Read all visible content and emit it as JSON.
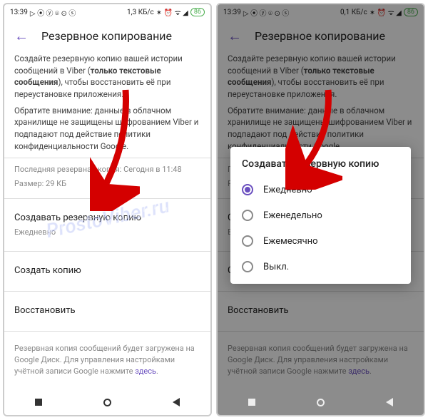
{
  "status": {
    "time": "13:39",
    "net_left": "1,3 КБ/с",
    "net_right": "0,1 КБ/с",
    "battery": "86"
  },
  "header": {
    "title": "Резервное копирование"
  },
  "intro": {
    "p1a": "Создайте резервную копию вашей истории сообщений в Viber (",
    "p1b": "только текстовые сообщения",
    "p1c": "), чтобы восстановить её при переустановке приложения.",
    "p2": "Обратите внимание: данные в облачном хранилище не защищены шифрованием Viber и подпадают под действие политики конфиденциальности Google."
  },
  "meta": {
    "last": "Последняя резервная копия: Сегодня в 11:48",
    "size": "Размер: 29 КБ"
  },
  "rows": {
    "schedule_title": "Создавать резервную копию",
    "schedule_value": "Ежедневно",
    "backup_now": "Создать копию",
    "restore": "Восстановить"
  },
  "footer": {
    "text": "Резервная копия сообщений будет загружена на Google Диск. Для управления настройками учётной записи Google нажмите ",
    "link": "здесь"
  },
  "dialog": {
    "title": "Создавать резервную копию",
    "options": [
      "Ежедневно",
      "Еженедельно",
      "Ежемесячно",
      "Выкл."
    ],
    "selected": 0
  },
  "watermark": "ProstoViber.ru"
}
